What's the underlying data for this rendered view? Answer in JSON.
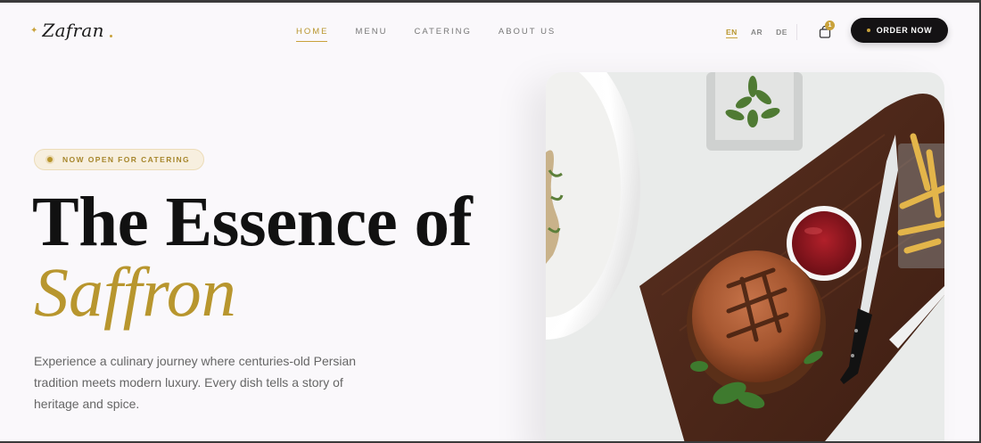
{
  "brand": {
    "name": "Zafran"
  },
  "nav": {
    "items": [
      {
        "label": "HOME",
        "active": true
      },
      {
        "label": "MENU",
        "active": false
      },
      {
        "label": "CATERING",
        "active": false
      },
      {
        "label": "ABOUT US",
        "active": false
      }
    ]
  },
  "languages": [
    {
      "code": "EN",
      "active": true
    },
    {
      "code": "AR",
      "active": false
    },
    {
      "code": "DE",
      "active": false
    }
  ],
  "cart": {
    "count": "1",
    "icon": "shopping-bag-icon"
  },
  "order_button": {
    "label": "ORDER NOW"
  },
  "hero": {
    "badge": "NOW OPEN FOR CATERING",
    "title_line1": "The Essence of",
    "title_line2": "Saffron",
    "description": "Experience a culinary journey where centuries-old Persian tradition meets modern luxury. Every dish tells a story of heritage and spice."
  },
  "colors": {
    "accent_gold": "#b8962e",
    "dark": "#141214",
    "background": "#faf8fb"
  }
}
